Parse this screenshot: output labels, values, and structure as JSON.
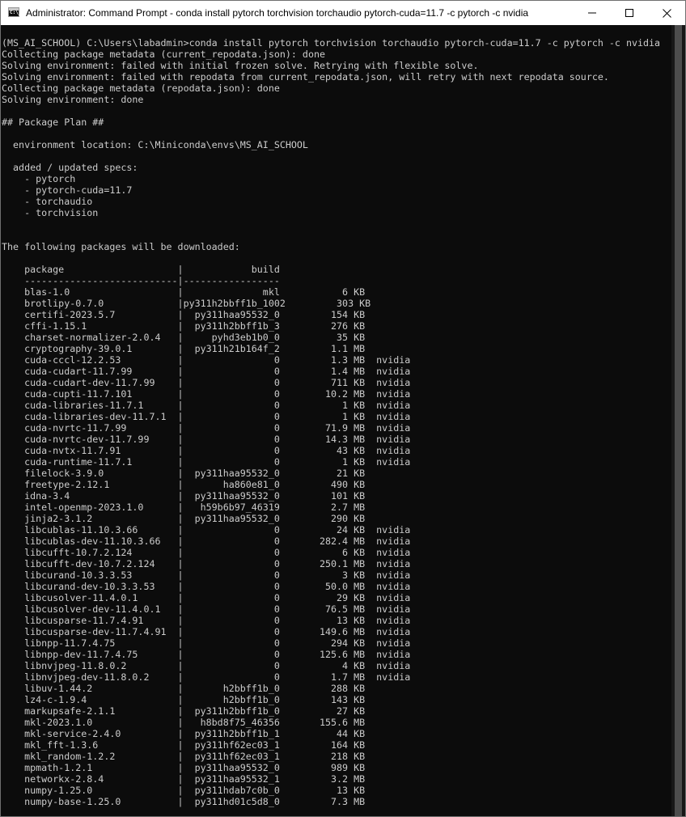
{
  "window": {
    "title": "Administrator: Command Prompt - conda  install pytorch torchvision torchaudio pytorch-cuda=11.7 -c pytorch -c nvidia",
    "app_icon_glyph": "C:\\_",
    "icons": {
      "app": "command-prompt-icon",
      "minimize": "minimize-icon",
      "maximize": "maximize-icon",
      "close": "close-icon"
    }
  },
  "terminal": {
    "colors": {
      "background": "#0c0c0c",
      "foreground": "#cccccc"
    },
    "lines": [
      "(MS_AI_SCHOOL) C:\\Users\\labadmin>conda install pytorch torchvision torchaudio pytorch-cuda=11.7 -c pytorch -c nvidia",
      "Collecting package metadata (current_repodata.json): done",
      "Solving environment: failed with initial frozen solve. Retrying with flexible solve.",
      "Solving environment: failed with repodata from current_repodata.json, will retry with next repodata source.",
      "Collecting package metadata (repodata.json): done",
      "Solving environment: done",
      "",
      "## Package Plan ##",
      "",
      "  environment location: C:\\Miniconda\\envs\\MS_AI_SCHOOL",
      "",
      "  added / updated specs:",
      "    - pytorch",
      "    - pytorch-cuda=11.7",
      "    - torchaudio",
      "    - torchvision",
      "",
      "",
      "The following packages will be downloaded:",
      "",
      "    package                    |            build",
      "    ---------------------------|-----------------",
      "    blas-1.0                   |              mkl           6 KB",
      "    brotlipy-0.7.0             |py311h2bbff1b_1002         303 KB",
      "    certifi-2023.5.7           |  py311haa95532_0         154 KB",
      "    cffi-1.15.1                |  py311h2bbff1b_3         276 KB",
      "    charset-normalizer-2.0.4   |     pyhd3eb1b0_0          35 KB",
      "    cryptography-39.0.1        |  py311h21b164f_2         1.1 MB",
      "    cuda-cccl-12.2.53          |                0         1.3 MB  nvidia",
      "    cuda-cudart-11.7.99        |                0         1.4 MB  nvidia",
      "    cuda-cudart-dev-11.7.99    |                0         711 KB  nvidia",
      "    cuda-cupti-11.7.101        |                0        10.2 MB  nvidia",
      "    cuda-libraries-11.7.1      |                0           1 KB  nvidia",
      "    cuda-libraries-dev-11.7.1  |                0           1 KB  nvidia",
      "    cuda-nvrtc-11.7.99         |                0        71.9 MB  nvidia",
      "    cuda-nvrtc-dev-11.7.99     |                0        14.3 MB  nvidia",
      "    cuda-nvtx-11.7.91          |                0          43 KB  nvidia",
      "    cuda-runtime-11.7.1        |                0           1 KB  nvidia",
      "    filelock-3.9.0             |  py311haa95532_0          21 KB",
      "    freetype-2.12.1            |       ha860e81_0         490 KB",
      "    idna-3.4                   |  py311haa95532_0         101 KB",
      "    intel-openmp-2023.1.0      |   h59b6b97_46319         2.7 MB",
      "    jinja2-3.1.2               |  py311haa95532_0         290 KB",
      "    libcublas-11.10.3.66       |                0          24 KB  nvidia",
      "    libcublas-dev-11.10.3.66   |                0       282.4 MB  nvidia",
      "    libcufft-10.7.2.124        |                0           6 KB  nvidia",
      "    libcufft-dev-10.7.2.124    |                0       250.1 MB  nvidia",
      "    libcurand-10.3.3.53        |                0           3 KB  nvidia",
      "    libcurand-dev-10.3.3.53    |                0        50.0 MB  nvidia",
      "    libcusolver-11.4.0.1       |                0          29 KB  nvidia",
      "    libcusolver-dev-11.4.0.1   |                0        76.5 MB  nvidia",
      "    libcusparse-11.7.4.91      |                0          13 KB  nvidia",
      "    libcusparse-dev-11.7.4.91  |                0       149.6 MB  nvidia",
      "    libnpp-11.7.4.75           |                0         294 KB  nvidia",
      "    libnpp-dev-11.7.4.75       |                0       125.6 MB  nvidia",
      "    libnvjpeg-11.8.0.2         |                0           4 KB  nvidia",
      "    libnvjpeg-dev-11.8.0.2     |                0         1.7 MB  nvidia",
      "    libuv-1.44.2               |       h2bbff1b_0         288 KB",
      "    lz4-c-1.9.4                |       h2bbff1b_0         143 KB",
      "    markupsafe-2.1.1           |  py311h2bbff1b_0          27 KB",
      "    mkl-2023.1.0               |   h8bd8f75_46356       155.6 MB",
      "    mkl-service-2.4.0          |  py311h2bbff1b_1          44 KB",
      "    mkl_fft-1.3.6              |  py311hf62ec03_1         164 KB",
      "    mkl_random-1.2.2           |  py311hf62ec03_1         218 KB",
      "    mpmath-1.2.1               |  py311haa95532_0         989 KB",
      "    networkx-2.8.4             |  py311haa95532_1         3.2 MB",
      "    numpy-1.25.0               |  py311hdab7c0b_0          13 KB",
      "    numpy-base-1.25.0          |  py311hd01c5d8_0         7.3 MB"
    ]
  }
}
